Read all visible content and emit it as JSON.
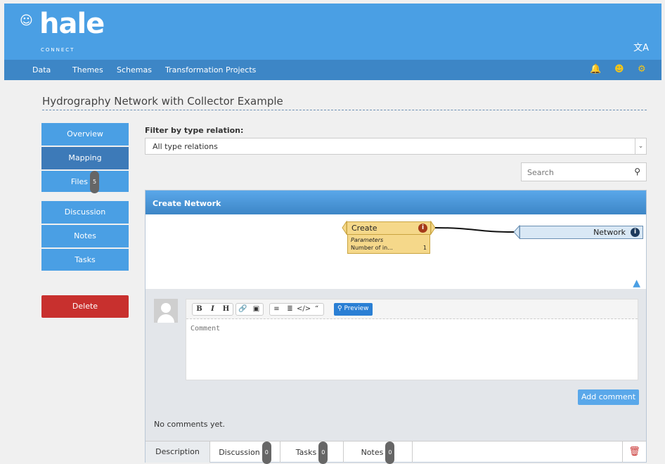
{
  "brand": {
    "word": "hale",
    "sub": "CONNECT"
  },
  "nav": {
    "items": [
      "Data",
      "Themes",
      "Schemas",
      "Transformation Projects"
    ]
  },
  "page_title": "Hydrography Network with Collector Example",
  "sidebar": {
    "items": [
      {
        "label": "Overview"
      },
      {
        "label": "Mapping"
      },
      {
        "label": "Files",
        "badge": "5"
      },
      {
        "label": "Discussion"
      },
      {
        "label": "Notes"
      },
      {
        "label": "Tasks"
      }
    ],
    "delete_label": "Delete"
  },
  "filter": {
    "label": "Filter by type relation:",
    "value": "All type relations"
  },
  "search": {
    "placeholder": "Search"
  },
  "panel": {
    "title": "Create Network",
    "create": {
      "title": "Create",
      "params_label": "Parameters",
      "param_name": "Number of in...",
      "param_value": "1"
    },
    "target": "Network"
  },
  "comments": {
    "placeholder": "Comment",
    "preview_label": "Preview",
    "add_label": "Add comment",
    "empty": "No comments yet."
  },
  "tabs": [
    {
      "label": "Description"
    },
    {
      "label": "Discussion",
      "badge": "0"
    },
    {
      "label": "Tasks",
      "badge": "0"
    },
    {
      "label": "Notes",
      "badge": "0"
    }
  ],
  "colors": {
    "header": "#4a9fe4",
    "navbar": "#3d86c6",
    "delete": "#c8302e",
    "function_box": "#f5d88a",
    "target_box": "#d9e8f5"
  }
}
